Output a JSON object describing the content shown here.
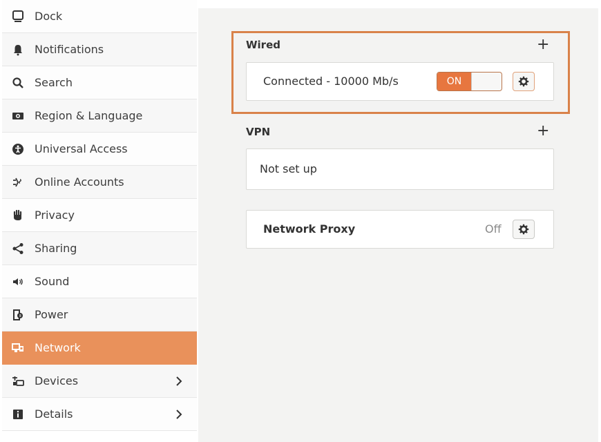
{
  "sidebar": {
    "items": [
      {
        "label": "Dock",
        "icon": "dock-icon"
      },
      {
        "label": "Notifications",
        "icon": "bell-icon"
      },
      {
        "label": "Search",
        "icon": "search-icon"
      },
      {
        "label": "Region & Language",
        "icon": "region-icon"
      },
      {
        "label": "Universal Access",
        "icon": "accessibility-icon"
      },
      {
        "label": "Online Accounts",
        "icon": "online-accounts-icon"
      },
      {
        "label": "Privacy",
        "icon": "hand-icon"
      },
      {
        "label": "Sharing",
        "icon": "share-icon"
      },
      {
        "label": "Sound",
        "icon": "speaker-icon"
      },
      {
        "label": "Power",
        "icon": "power-icon"
      },
      {
        "label": "Network",
        "icon": "network-icon",
        "active": true
      },
      {
        "label": "Devices",
        "icon": "devices-icon",
        "has_chevron": true
      },
      {
        "label": "Details",
        "icon": "info-icon",
        "has_chevron": true
      }
    ]
  },
  "main": {
    "wired": {
      "title": "Wired",
      "add_symbol": "+",
      "status": "Connected - 10000 Mb/s",
      "switch_label": "ON",
      "switch_state": "on"
    },
    "vpn": {
      "title": "VPN",
      "add_symbol": "+",
      "status": "Not set up"
    },
    "proxy": {
      "title": "Network Proxy",
      "status": "Off"
    }
  },
  "colors": {
    "accent": "#e9915b",
    "switch_on": "#e7763f",
    "highlight_border": "#d9824a",
    "main_bg": "#f3f3f2"
  }
}
